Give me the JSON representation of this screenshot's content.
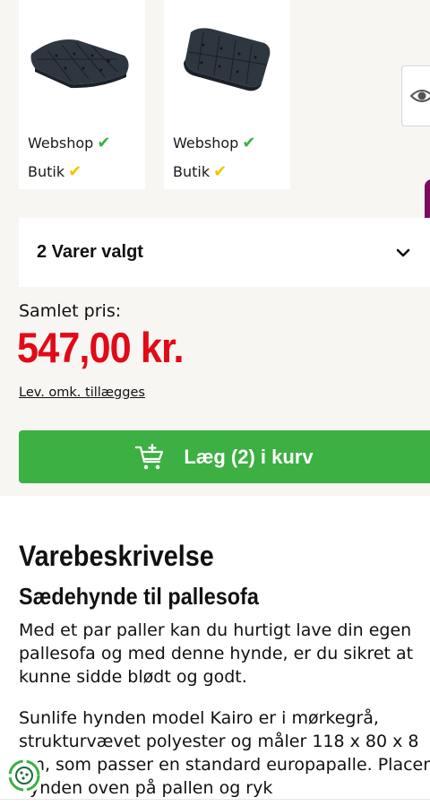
{
  "products": [
    {
      "name": "Seat cushion flat",
      "webshop_label": "Webshop",
      "store_label": "Butik",
      "webshop_status": "check-green",
      "store_status": "check-yellow"
    },
    {
      "name": "Back cushion",
      "webshop_label": "Webshop",
      "store_label": "Butik",
      "webshop_status": "check-green",
      "store_status": "check-yellow"
    }
  ],
  "selection": {
    "label": "2 Varer valgt",
    "icon": "chevron-down-icon"
  },
  "total": {
    "label": "Samlet pris:",
    "price": "547,00 kr.",
    "shipping_note": "Lev. omk. tillægges"
  },
  "cart_button": {
    "label": "Læg (2) i kurv",
    "icon": "cart-add-icon"
  },
  "description": {
    "title": "Varebeskrivelse",
    "subtitle": "Sædehynde til pallesofa",
    "paragraph1": "Med et par paller kan du hurtigt lave din egen pallesofa og med denne hynde, er du sikret at kunne sidde blødt og godt.",
    "paragraph2": "Sunlife hynden model Kairo er i mørkegrå, strukturvævet polyester og måler 118 x 80 x 8 cm, som passer en standard europapalle. Placer hynden oven på pallen og ryk"
  },
  "colors": {
    "accent_green": "#3cb043",
    "price_red": "#e10a17",
    "store_yellow": "#f5c400",
    "tab_purple": "#7a0c5c"
  }
}
